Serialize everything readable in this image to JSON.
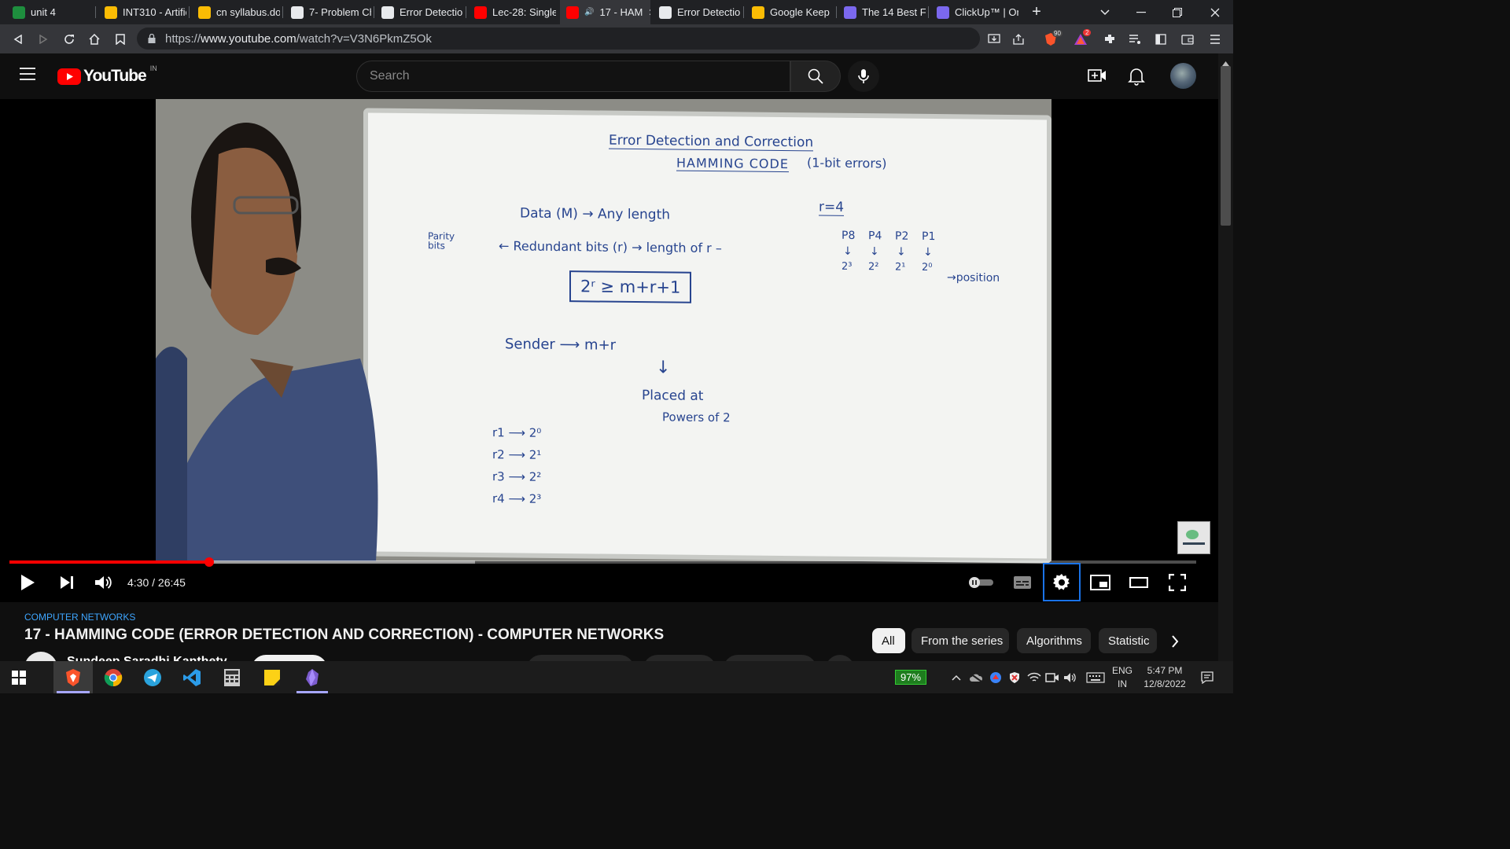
{
  "browser": {
    "tabs": [
      {
        "title": "unit 4",
        "icon": "classroom-icon",
        "color": "#1e8e3e"
      },
      {
        "title": "INT310 - Artific",
        "icon": "drive-icon",
        "color": "#fbbc04"
      },
      {
        "title": "cn syllabus.doc",
        "icon": "drive-icon",
        "color": "#fbbc04"
      },
      {
        "title": "7- Problem Ch",
        "icon": "globe-icon",
        "color": "#e8eaed"
      },
      {
        "title": "Error Detection",
        "icon": "site-icon",
        "color": "#e8eaed"
      },
      {
        "title": "Lec-28: Single",
        "icon": "youtube-icon",
        "color": "#ff0000"
      },
      {
        "title": "17 - HAM",
        "icon": "youtube-icon",
        "color": "#ff0000",
        "active": true
      },
      {
        "title": "Error Detection",
        "icon": "site-icon",
        "color": "#e8eaed"
      },
      {
        "title": "Google Keep",
        "icon": "keep-icon",
        "color": "#fbbc04"
      },
      {
        "title": "The 14 Best Fre",
        "icon": "clickup-icon",
        "color": "#7b68ee"
      },
      {
        "title": "ClickUp™ | On",
        "icon": "clickup-icon",
        "color": "#7b68ee"
      }
    ],
    "url_prefix": "https://",
    "url_host": "www.youtube.com",
    "url_path": "/watch?v=V3N6PkmZ5Ok",
    "brave_badge": "90",
    "rewards_badge": "2"
  },
  "youtube": {
    "logo_text": "YouTube",
    "region": "IN",
    "search_placeholder": "Search",
    "player": {
      "current_time": "4:30",
      "duration": "26:45",
      "time_display": "4:30 / 26:45",
      "progress_fraction": 0.168,
      "buffered_fraction": 0.392
    },
    "whiteboard": {
      "title1": "Error Detection and Correction",
      "title2": "HAMMING CODE",
      "title2_note": "(1-bit errors)",
      "data_line": "Data (M) → Any length",
      "parity_label": "Parity bits",
      "redundant_line": "← Redundant bits (r) → length of r –",
      "formula": "2ʳ ≥ m+r+1",
      "r_value": "r=4",
      "p_labels": [
        "P8",
        "P4",
        "P2",
        "P1"
      ],
      "p_powers": [
        "2³",
        "2²",
        "2¹",
        "2⁰"
      ],
      "position_label": "→position",
      "sender_line": "Sender ⟶ m+r",
      "arrow_down": "↓",
      "placed_at": "Placed at",
      "powers_of_2": "Powers of 2",
      "r_list": [
        "r1 ⟶ 2⁰",
        "r2 ⟶ 2¹",
        "r3 ⟶ 2²",
        "r4 ⟶ 2³"
      ]
    },
    "video": {
      "series_label": "COMPUTER NETWORKS",
      "title": "17 - HAMMING CODE (ERROR DETECTION AND CORRECTION) - COMPUTER NETWORKS",
      "channel_partial": "Sundeep Saradhi Kanthety"
    },
    "chips": [
      "All",
      "From the series",
      "Algorithms",
      "Statistic"
    ]
  },
  "taskbar": {
    "battery": "97%",
    "lang": "ENG",
    "region": "IN",
    "time": "5:47 PM",
    "date": "12/8/2022"
  },
  "colors": {
    "accent_red": "#ff0000",
    "link_blue": "#3ea6ff",
    "marker_blue": "#27448f",
    "focus_blue": "#1a73e8"
  }
}
